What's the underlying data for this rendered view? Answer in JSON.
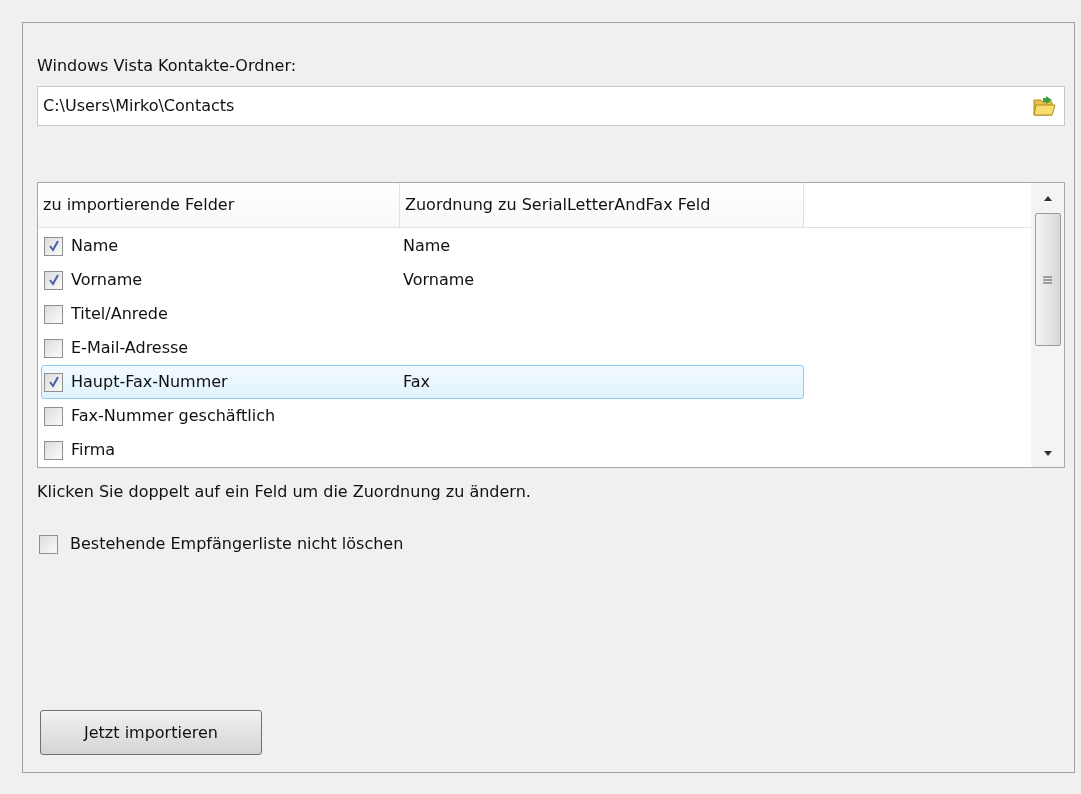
{
  "folder": {
    "label": "Windows Vista Kontakte-Ordner:",
    "value": "C:\\Users\\Mirko\\Contacts"
  },
  "fields_table": {
    "columns": [
      "zu importierende Felder",
      "Zuordnung zu SerialLetterAndFax Feld"
    ],
    "rows": [
      {
        "field": "Name",
        "mapping": "Name",
        "checked": true,
        "selected": false
      },
      {
        "field": "Vorname",
        "mapping": "Vorname",
        "checked": true,
        "selected": false
      },
      {
        "field": "Titel/Anrede",
        "checked": false,
        "selected": false
      },
      {
        "field": "E-Mail-Adresse",
        "checked": false,
        "selected": false
      },
      {
        "field": "Haupt-Fax-Nummer",
        "mapping": "Fax",
        "checked": true,
        "selected": true
      },
      {
        "field": "Fax-Nummer geschäftlich",
        "checked": false,
        "selected": false
      },
      {
        "field": "Firma",
        "checked": false,
        "selected": false
      }
    ]
  },
  "hint": "Klicken Sie doppelt auf ein Feld um die Zuordnung zu ändern.",
  "keep_list": {
    "label": "Bestehende Empfängerliste nicht löschen",
    "checked": false
  },
  "import_button": "Jetzt importieren"
}
